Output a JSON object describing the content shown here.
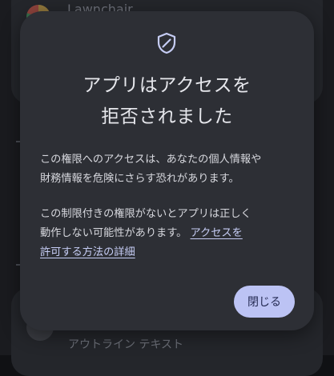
{
  "background": {
    "app_name": "Lawnchair",
    "outline_text": "アウトライン テキスト"
  },
  "dialog": {
    "icon": "shield-icon",
    "title_line1": "アプリはアクセスを",
    "title_line2": "拒否されました",
    "para1_line1": "この権限へのアクセスは、あなたの個人情報や",
    "para1_line2": "財務情報を危険にさらす恐れがあります。",
    "para2_line1": "この制限付きの権限がないとアプリは正しく",
    "para2_line2_prefix": "動作しない可能性があります。",
    "link_part1": "アクセスを",
    "link_part2": "許可する方法の詳細",
    "close_label": "閉じる"
  },
  "colors": {
    "dialog_bg": "#2d2f35",
    "link": "#c6cdf5",
    "button_bg": "#bcc3f4",
    "button_text": "#242a52"
  }
}
